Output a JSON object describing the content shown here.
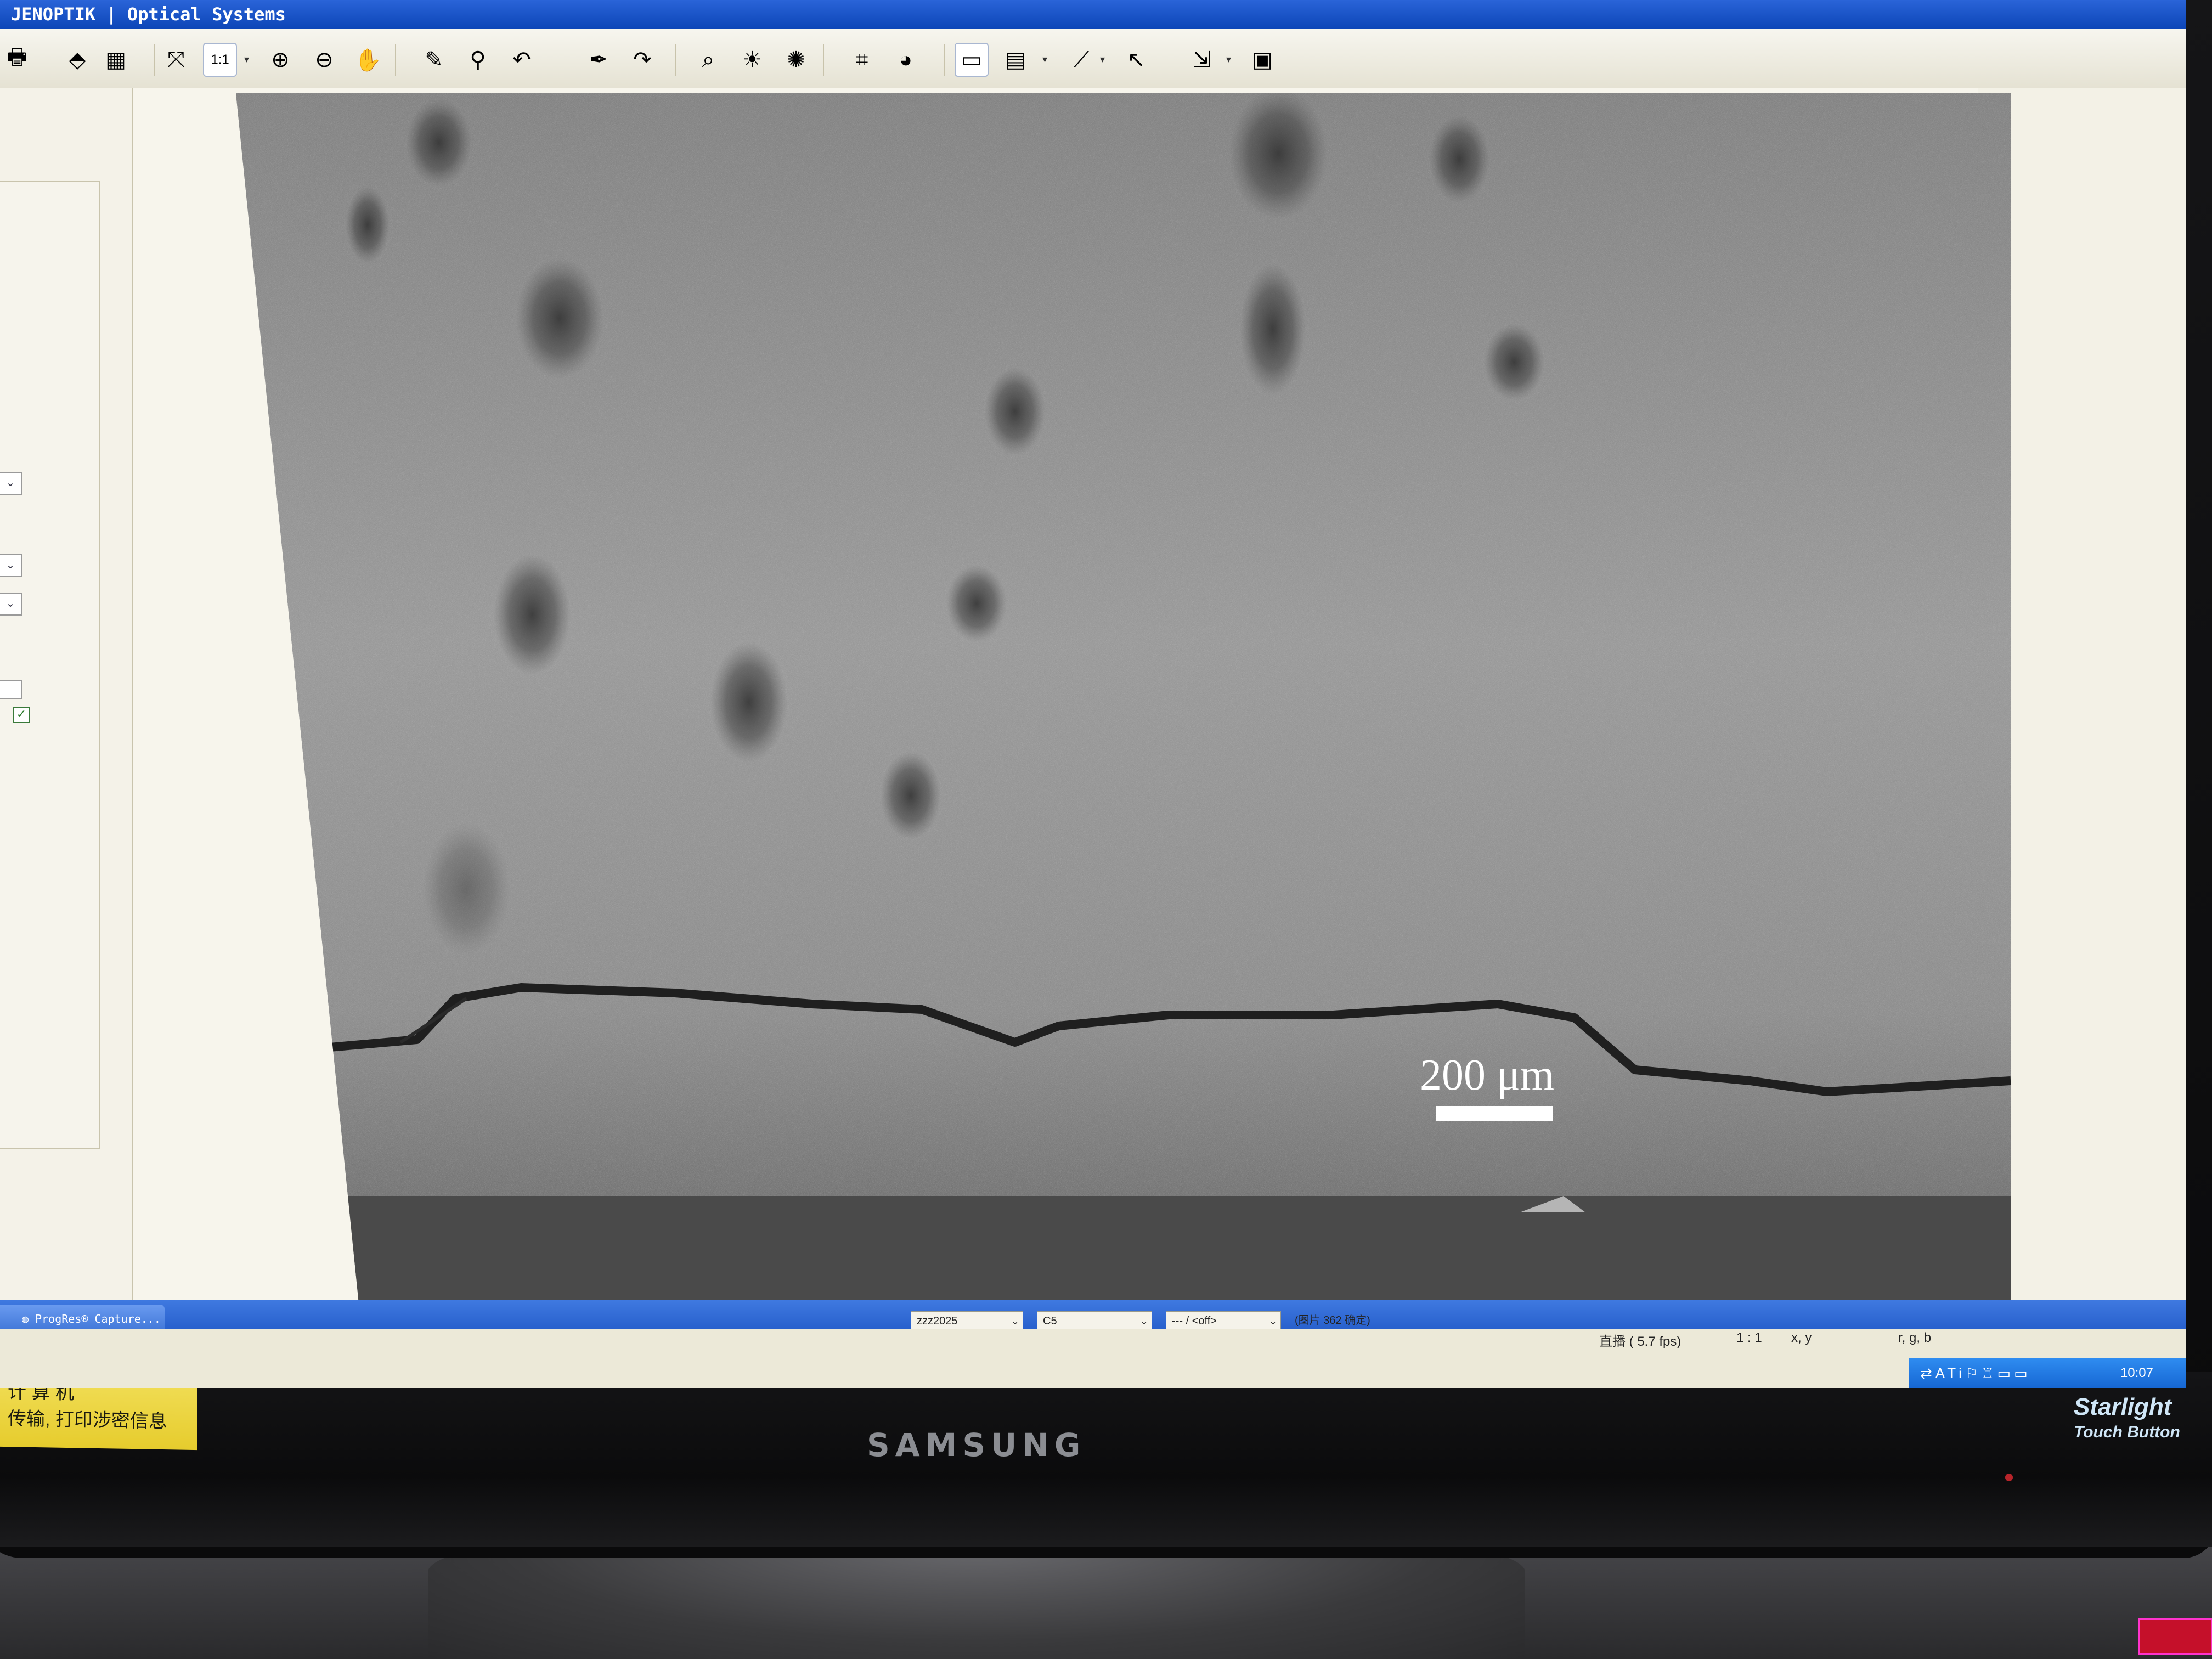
{
  "window": {
    "title": "JENOPTIK | Optical Systems"
  },
  "toolbar": {
    "buttons": [
      {
        "name": "print-icon",
        "glyph": "🖶"
      },
      {
        "name": "acquire-icon",
        "glyph": "⬘"
      },
      {
        "name": "image-gallery-icon",
        "glyph": "▦"
      },
      {
        "name": "fit-window-icon",
        "glyph": "⤧"
      },
      {
        "name": "zoom-1to1-icon",
        "glyph": "1:1"
      },
      {
        "name": "zoom-in-icon",
        "glyph": "⊕"
      },
      {
        "name": "zoom-out-icon",
        "glyph": "⊖"
      },
      {
        "name": "hand-pan-icon",
        "glyph": "✋"
      },
      {
        "name": "pipette-icon",
        "glyph": "✎"
      },
      {
        "name": "white-balance-icon",
        "glyph": "⚲"
      },
      {
        "name": "undo-icon",
        "glyph": "↶"
      },
      {
        "name": "eyedropper-icon",
        "glyph": "✒"
      },
      {
        "name": "redo-arrow-icon",
        "glyph": "↷"
      },
      {
        "name": "find-icon",
        "glyph": "⌕"
      },
      {
        "name": "brightness-icon",
        "glyph": "☀"
      },
      {
        "name": "exposure-icon",
        "glyph": "✺"
      },
      {
        "name": "crop-icon",
        "glyph": "⌗"
      },
      {
        "name": "color-icon",
        "glyph": "◕"
      },
      {
        "name": "overlay-icon",
        "glyph": "▭"
      },
      {
        "name": "ruler-icon",
        "glyph": "▤"
      },
      {
        "name": "line-measure-icon",
        "glyph": "⟋"
      },
      {
        "name": "pointer-icon",
        "glyph": "↖"
      },
      {
        "name": "export-icon",
        "glyph": "⇲"
      },
      {
        "name": "toolbox-icon",
        "glyph": "▣"
      }
    ]
  },
  "image": {
    "scale_label": "200 μm"
  },
  "taskbar": {
    "task": "ProgRes® Capture..."
  },
  "statusbar": {
    "profile": "zzz2025",
    "camera": "C5",
    "mode": "--- / <off>",
    "image_count": "(图片 362 确定)",
    "live": "直播 ( 5.7 fps)",
    "zoom": "1 : 1",
    "coords": "x, y",
    "rgb": "r, g, b"
  },
  "tray": {
    "clock": "10:07",
    "icons": "⇄ATi⚐♖▭▭"
  },
  "bezel": {
    "brand": "SAMSUNG",
    "sticker_line1": "计 算 机",
    "sticker_line2": "传输, 打印涉密信息",
    "starlight_1": "Starlight",
    "starlight_2": "Touch Button"
  },
  "colors": {
    "titlebar": "#0d46b8",
    "taskbar": "#2058c6",
    "micro_bg": "#8a8a8a"
  }
}
